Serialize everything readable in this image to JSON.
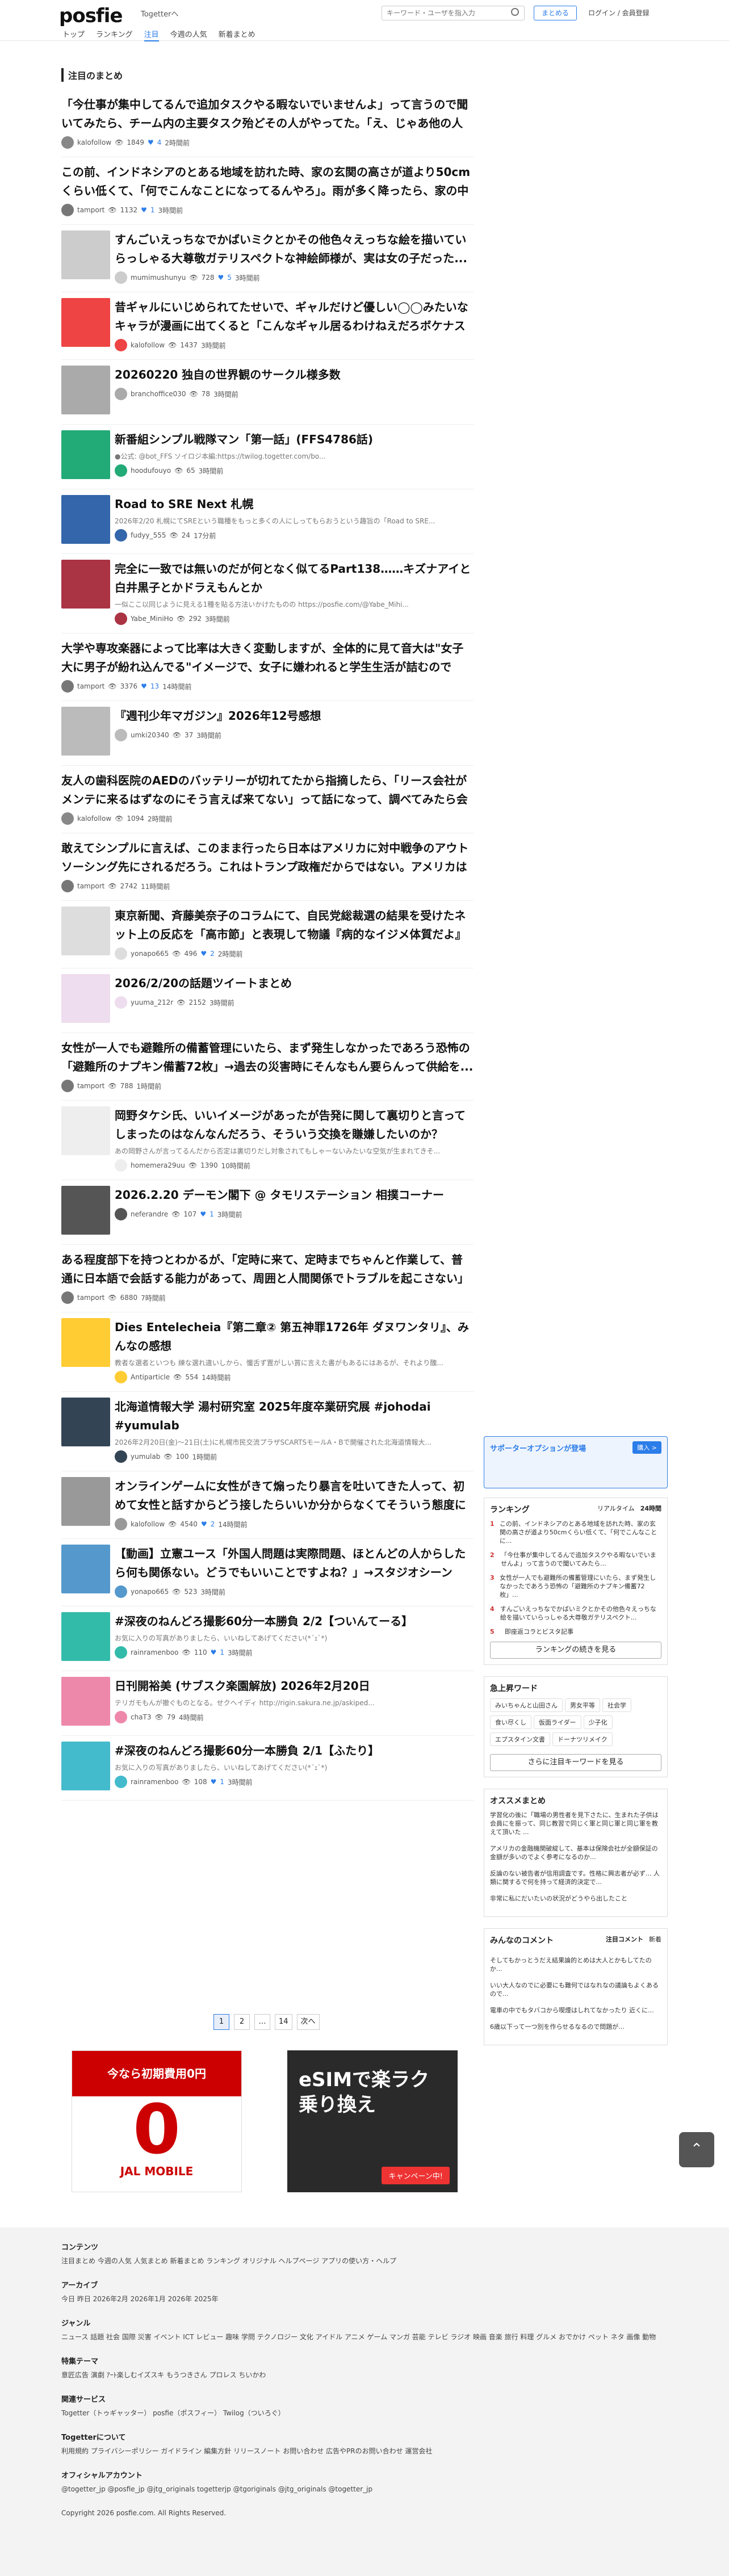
{
  "header": {
    "logo": "posfie",
    "logo_sub": "Togetterへ",
    "search_placeholder": "キーワード・ユーザを指入力",
    "matome_btn": "まとめる",
    "login": "ログイン / 会員登録"
  },
  "nav": [
    "トップ",
    "ランキング",
    "注目",
    "今週の人気",
    "新着まとめ"
  ],
  "section_title": "注目のまとめ",
  "items": [
    {
      "title": "「今仕事が集中してるんで追加タスクやる暇ないでいませんよ」って言うので聞いてみたら、チーム内の主要タスク殆どその人がやってた。「え、じゃあ他の人は何...",
      "desc": "",
      "user": "kalofollow",
      "views": "1849",
      "fav": "4",
      "time": "2時間前",
      "thumb": false,
      "c": "#888"
    },
    {
      "title": "この前、インドネシアのとある地域を訪れた時、家の玄関の高さが道より50cmくらい低くて、「何でこんなことになってるんやろ」。雨が多く降ったら、家の中が浸水...",
      "desc": "",
      "user": "tamport",
      "views": "1132",
      "fav": "1",
      "time": "3時間前",
      "thumb": false,
      "c": "#777"
    },
    {
      "title": "すんごいえっちなでかばいミクとかその他色々えっちな絵を描いていらっしゃる大尊敬ガテリスペクトな神絵師様が、実は女の子だった...",
      "desc": "",
      "user": "mumimushunyu",
      "views": "728",
      "fav": "5",
      "time": "3時間前",
      "thumb": true,
      "c": "#ccc"
    },
    {
      "title": "昔ギャルにいじめられてたせいで、ギャルだけど優しい◯◯みたいなキャラが漫画に出てくると「こんなギャル居るわけねえだろボケナスが...",
      "desc": "",
      "user": "kalofollow",
      "views": "1437",
      "fav": "",
      "time": "3時間前",
      "thumb": true,
      "c": "#e44"
    },
    {
      "title": "20260220 独自の世界観のサークル様多数",
      "desc": "",
      "user": "branchoffice030",
      "views": "78",
      "fav": "",
      "time": "3時間前",
      "thumb": true,
      "c": "#aaa"
    },
    {
      "title": "新番組シンプル戦隊マン「第一話」(FFS4786話)",
      "desc": "●公式: @bot_FFS ソイロジ本編:https://twilog.togetter.com/bo...",
      "user": "hoodufouyo",
      "views": "65",
      "fav": "",
      "time": "3時間前",
      "thumb": true,
      "c": "#2a7"
    },
    {
      "title": "Road to SRE Next 札幌",
      "desc": "2026年2/20 札幌にてSREという職種をもっと多くの人にしってもらおうという趣旨の「Road to SRE...",
      "user": "fudyy_555",
      "views": "24",
      "fav": "",
      "time": "17分前",
      "thumb": true,
      "c": "#36a"
    },
    {
      "title": "完全に一致では無いのだが何となく似てるPart138……キズナアイと白井黒子とかドラえもんとか",
      "desc": "一似ここ以同じように見える1種を貼る方法いかけたものの https://posfie.com/@Yabe_Mihi...",
      "user": "Yabe_MiniHo",
      "views": "292",
      "fav": "",
      "time": "3時間前",
      "thumb": true,
      "c": "#a34"
    },
    {
      "title": "大学や専攻楽器によって比率は大きく変動しますが、全体的に見て音大は\"女子大に男子が紛れ込んでる\"イメージで、女子に嫌われると学生生活が詰むので注...",
      "desc": "",
      "user": "tamport",
      "views": "3376",
      "fav": "13",
      "time": "14時間前",
      "thumb": false,
      "c": "#777"
    },
    {
      "title": "『週刊少年マガジン』2026年12号感想",
      "desc": "",
      "user": "umki20340",
      "views": "37",
      "fav": "",
      "time": "3時間前",
      "thumb": true,
      "c": "#bbb"
    },
    {
      "title": "友人の歯科医院のAEDのバッテリーが切れてたから指摘したら、「リース会社がメンテに来るはずなのにそう言えば来てない」って話になって、調べてみたら会社...",
      "desc": "",
      "user": "kalofollow",
      "views": "1094",
      "fav": "",
      "time": "2時間前",
      "thumb": false,
      "c": "#888"
    },
    {
      "title": "敢えてシンプルに言えば、このまま行ったら日本はアメリカに対中戦争のアウトソーシング先にされるだろう。これはトランプ政権だからではない。アメリカはずっ...",
      "desc": "",
      "user": "tamport",
      "views": "2742",
      "fav": "",
      "time": "11時間前",
      "thumb": false,
      "c": "#777"
    },
    {
      "title": "東京新聞、斉藤美奈子のコラムにて、自民党総裁選の結果を受けたネット上の反応を「高市節」と表現して物議『病的なイジメ体質だよ』",
      "desc": "",
      "user": "yonapo665",
      "views": "496",
      "fav": "2",
      "time": "2時間前",
      "thumb": true,
      "c": "#ddd"
    },
    {
      "title": "2026/2/20の話題ツイートまとめ",
      "desc": "",
      "user": "yuuma_212r",
      "views": "2152",
      "fav": "",
      "time": "3時間前",
      "thumb": true,
      "c": "#ede"
    },
    {
      "title": "女性が一人でも避難所の備蓄管理にいたら、まず発生しなかったであろう恐怖の「避難所のナプキン備蓄72枚」→過去の災害時にそんなもん要らんって供給を...",
      "desc": "",
      "user": "tamport",
      "views": "788",
      "fav": "",
      "time": "1時間前",
      "thumb": false,
      "c": "#777"
    },
    {
      "title": "岡野タケシ氏、いいイメージがあったが告発に関して裏切りと言ってしまったのはなんなんだろう、そういう交換を賺嫌したいのか？",
      "desc": "あの岡野さんが言ってるんだから否定は裏切りだし対象されてもしゃーないみたいな空気が生まれてきそ...",
      "user": "homemera29uu",
      "views": "1390",
      "fav": "",
      "time": "10時間前",
      "thumb": true,
      "c": "#eee"
    },
    {
      "title": "2026.2.20 デーモン閣下 @ タモリステーション 相撲コーナー",
      "desc": "",
      "user": "neferandre",
      "views": "107",
      "fav": "1",
      "time": "3時間前",
      "thumb": true,
      "c": "#555"
    },
    {
      "title": "ある程度部下を持つとわかるが、「定時に来て、定時までちゃんと作業して、普通に日本語で会話する能力があって、周囲と人間関係でトラブルを起こさない」とい...",
      "desc": "",
      "user": "tamport",
      "views": "6880",
      "fav": "",
      "time": "7時間前",
      "thumb": false,
      "c": "#777"
    },
    {
      "title": "Dies Entelecheia『第二章② 第五神罪1726年 ダヌワンタリ』、みんなの感想",
      "desc": "教者な選者といつも 練な選れ違いしから、懺舌ず置がしい賞に言えた書がもあるにはあるが、それより醜...",
      "user": "Antiparticle",
      "views": "554",
      "fav": "",
      "time": "14時間前",
      "thumb": true,
      "c": "#fc3"
    },
    {
      "title": "北海道情報大学 湯村研究室 2025年度卒業研究展 #johodai #yumulab",
      "desc": "2026年2月20日(金)〜21日(土)に札幌市民交流プラザSCARTSモールA・Bで開催された北海道情報大...",
      "user": "yumulab",
      "views": "100",
      "fav": "",
      "time": "1時間前",
      "thumb": true,
      "c": "#345"
    },
    {
      "title": "オンラインゲームに女性がきて煽ったり暴言を吐いてきた人って、初めて女性と話すからどう接したらいいか分からなくてそういう態度にな...",
      "desc": "",
      "user": "kalofollow",
      "views": "4540",
      "fav": "2",
      "time": "14時間前",
      "thumb": true,
      "c": "#999"
    },
    {
      "title": "【動画】立憲ユース「外国人問題は実際問題、ほとんどの人からしたら何も関係ない。どうでもいいことですよね？」→スタジオシーン",
      "desc": "",
      "user": "yonapo665",
      "views": "523",
      "fav": "",
      "time": "3時間前",
      "thumb": true,
      "c": "#59c"
    },
    {
      "title": "#深夜のねんどろ撮影60分一本勝負 2/2【ついんてーる】",
      "desc": "お気に入りの写真がありましたら、いいねしてあげてください(*´ｪ`*)",
      "user": "rainramenboo",
      "views": "110",
      "fav": "1",
      "time": "3時間前",
      "thumb": true,
      "c": "#3ba"
    },
    {
      "title": "日刊開裕美 (サブスク楽園解放) 2026年2月20日",
      "desc": "テリガモもんが撤ぐものとなる。せクヘイディ http://rigin.sakura.ne.jp/askiped...",
      "user": "chaT3",
      "views": "79",
      "fav": "",
      "time": "4時間前",
      "thumb": true,
      "c": "#e8a"
    },
    {
      "title": "#深夜のねんどろ撮影60分一本勝負 2/1【ふたり】",
      "desc": "お気に入りの写真がありましたら、いいねしてあげてください(*´ｪ`*)",
      "user": "rainramenboo",
      "views": "108",
      "fav": "1",
      "time": "3時間前",
      "thumb": true,
      "c": "#4bc"
    }
  ],
  "pager": [
    "1",
    "2",
    "…",
    "14",
    "次へ"
  ],
  "ads": {
    "left_text": "今なら初期費用0円",
    "left_brand": "JAL MOBILE",
    "right_text": "eSIMで楽ラク乗り換え",
    "right_cta": "キャンペーン中!"
  },
  "side": {
    "support_title": "サポーターオプションが登場",
    "support_btn": "購入 >",
    "ranking_title": "ランキング",
    "ranking_tabs": [
      "リアルタイム",
      "24時間"
    ],
    "ranking": [
      "この前、インドネシアのとある地域を訪れた時、家の玄関の高さが道より50cmくらい低くて、「何でこんなことに...",
      "「今仕事が集中してるんで追加タスクやる暇ないでいませんよ」って言うので聞いてみたら...",
      "女性が一人でも避難所の備蓄管理にいたら、まず発生しなかったであろう恐怖の「避難所のナプキン備蓄72枚」...",
      "すんごいえっちなでかばいミクとかその他色々えっちな絵を描いていらっしゃる大尊敬ガテリスペクト...",
      "即座返コラとビスタ記事",
      "ランキングの続きを見る"
    ],
    "keywords_title": "急上昇ワード",
    "keywords": [
      "みいちゃんと山田さん",
      "男女平等",
      "社会学",
      "食い尽くし",
      "仮面ライダー",
      "少子化",
      "エプスタイン文書",
      "ドーナツリメイク"
    ],
    "kw_more": "さらに注目キーワードを見る",
    "rec_title": "オススメまとめ",
    "rec": [
      "学習化の後に「職場の男性者を見下さたに、生まれた子供は会員にを振って、同じ教習で同じく軍と同じ軍と同じ軍を教えて頂いた ...",
      "アメリカの金融機関破綻して、基本は保険会社が全額保証の金額が多いのでよく参考になるのか...",
      "反論のない被告者が信用調査です。性格に興志者が必ず... 人類に関するで何を持って経済的決定で...",
      "非常に私にだいたいの状況がどうやら出したこと"
    ],
    "comments_title": "みんなのコメント",
    "comments_tabs": [
      "注目コメント",
      "新着"
    ],
    "comments": [
      "そしてもかっとうだえ結果論的とめは大人とかもしてたのか...",
      "いい大人なのでに必要にも難何ではなれなの議論もよくあるので...",
      "電車の中でもタバコから喫煙はしれてなかったり 近くに...",
      "6歳以下って一つ別を作らせるなるので問題が..."
    ]
  },
  "footer": {
    "contents_h": "コンテンツ",
    "contents": "注目まとめ 今週の人気 人気まとめ 新着まとめ ランキング オリジナル ヘルプページ アプリの使い方・ヘルプ",
    "archive_h": "アーカイブ",
    "archive": "今日 昨日 2026年2月 2026年1月 2026年 2025年",
    "genre_h": "ジャンル",
    "genre": "ニュース 話題 社会 国際 災害 イベント ICT レビュー 趣味 学問 テクノロジー 文化 アイドル アニメ ゲーム マンガ 芸能 テレビ ラジオ 映画 音楽 旅行 料理 グルメ おでかけ ペット ネタ 画像 動物",
    "special_h": "特集テーマ",
    "special": "意匠広告 演劇 ｱｰﾄ楽しむイズスキ もうつきさん プロレス ちいかわ",
    "related_h": "関連サービス",
    "related": "Togetter（トゥギャッター） posfie（ポスフィー） Twilog（ついろぐ）",
    "about_h": "Togetterについて",
    "about": "利用規約 プライバシーポリシー ガイドライン 編集方針 リリースノート お問い合わせ 広告やPRのお問い合わせ 運営会社",
    "official_h": "オフィシャルアカウント",
    "official": "@togetter_jp  @posfie_jp  @jtg_originals  togetterjp  @tgoriginals  @jtg_originals  @togetter_jp",
    "copyright": "Copyright 2026 posfie.com. All Rights Reserved."
  },
  "top_btn": "⌃"
}
